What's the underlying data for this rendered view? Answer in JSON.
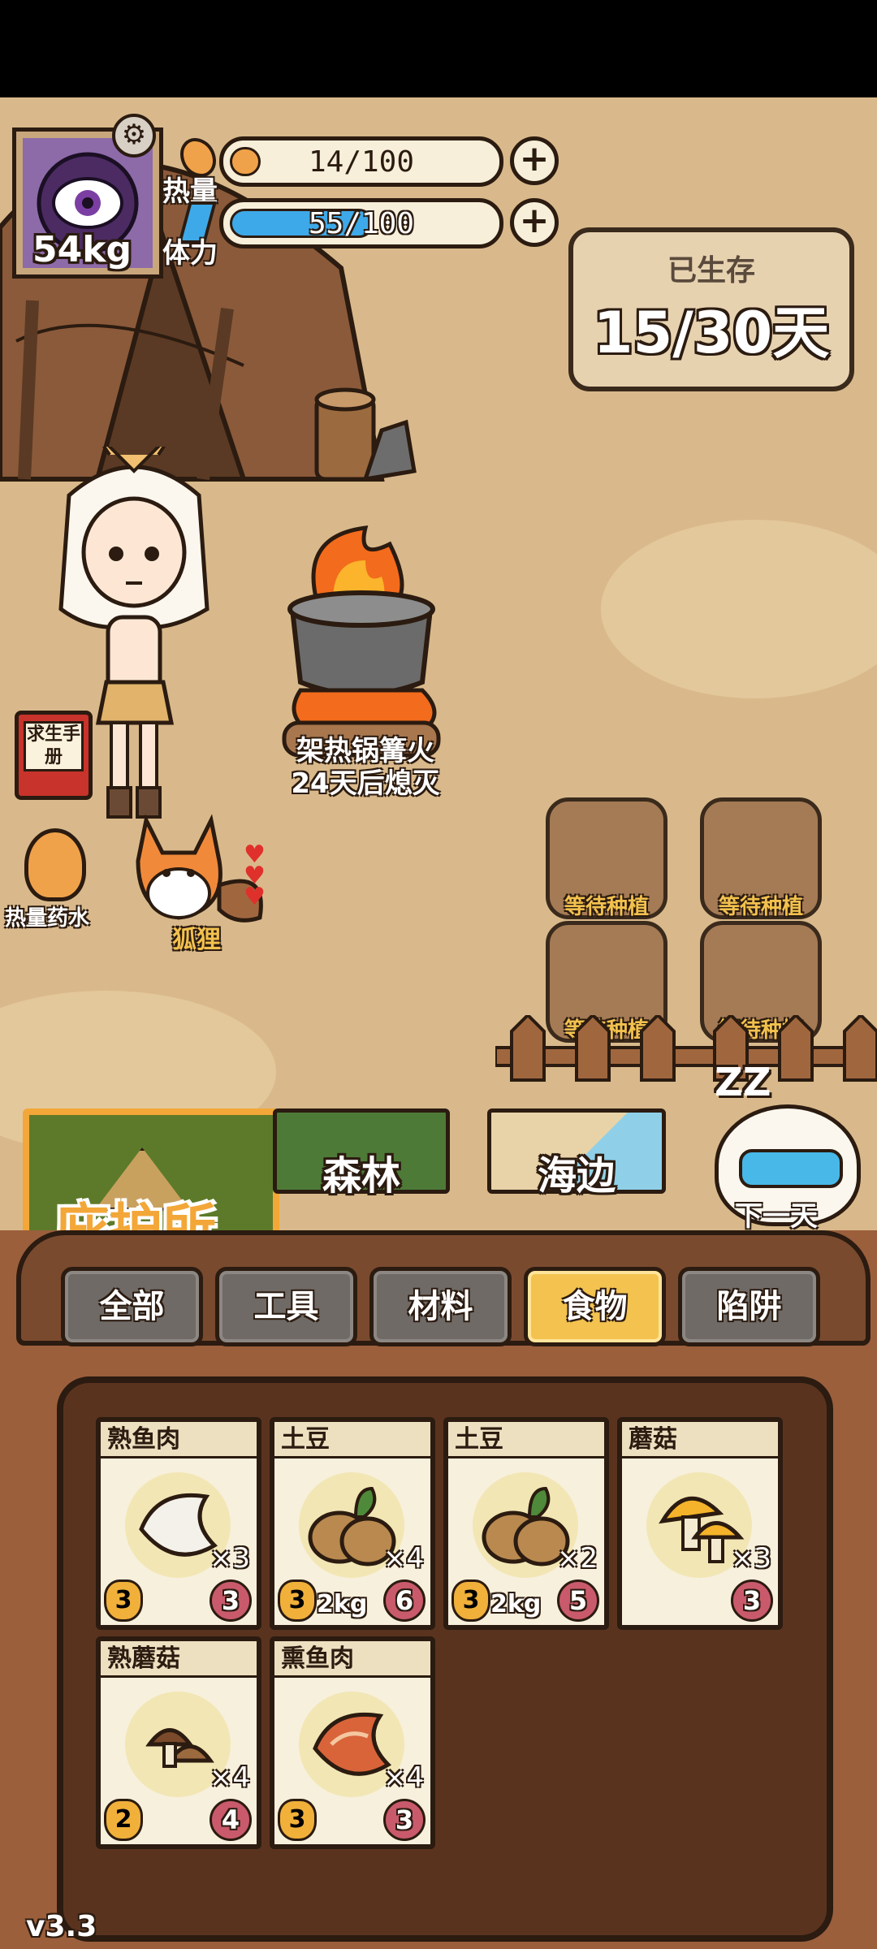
{
  "player": {
    "weight": "54kg",
    "avatar_icon": "eye-monster-icon",
    "settings_icon": "gear-icon"
  },
  "stats": {
    "heat": {
      "label": "热量",
      "value": "14/100",
      "current": 14,
      "max": 100,
      "color": "#f0a24a"
    },
    "stamina": {
      "label": "体力",
      "value": "55/100",
      "current": 55,
      "max": 100,
      "color": "#3ea9e8"
    }
  },
  "survival": {
    "label": "已生存",
    "current": "15",
    "separator": "/",
    "total": "30天"
  },
  "campfire": {
    "line1": "架热锅篝火",
    "line2": "24天后熄灭"
  },
  "side_items": {
    "manual": {
      "label": "求生手册"
    },
    "potion": {
      "label": "热量药水"
    }
  },
  "pet": {
    "name": "狐狸",
    "hearts": 3
  },
  "plots": [
    "等待种植",
    "等待种植",
    "等待种植",
    "等待种植"
  ],
  "locations": {
    "shelter": "庇护所",
    "forest": "森林",
    "seaside": "海边"
  },
  "next_day": {
    "label": "下一天",
    "sleep_text": "ZZ"
  },
  "tabs": [
    {
      "label": "全部",
      "active": false
    },
    {
      "label": "工具",
      "active": false
    },
    {
      "label": "材料",
      "active": false
    },
    {
      "label": "食物",
      "active": true
    },
    {
      "label": "陷阱",
      "active": false
    }
  ],
  "inventory": [
    {
      "name": "熟鱼肉",
      "qty": "×3",
      "heat": "3",
      "weight": "",
      "satiety": "3",
      "icon": "cooked-fish-icon"
    },
    {
      "name": "土豆",
      "qty": "×4",
      "heat": "3",
      "weight": "2kg",
      "satiety": "6",
      "icon": "potato-icon"
    },
    {
      "name": "土豆",
      "qty": "×2",
      "heat": "3",
      "weight": "2kg",
      "satiety": "5",
      "icon": "potato-icon"
    },
    {
      "name": "蘑菇",
      "qty": "×3",
      "heat": "",
      "weight": "",
      "satiety": "3",
      "icon": "mushroom-icon"
    },
    {
      "name": "熟蘑菇",
      "qty": "×4",
      "heat": "2",
      "weight": "",
      "satiety": "4",
      "icon": "cooked-mushroom-icon"
    },
    {
      "name": "熏鱼肉",
      "qty": "×4",
      "heat": "3",
      "weight": "",
      "satiety": "3",
      "icon": "smoked-fish-icon"
    }
  ],
  "version": "v3.3"
}
